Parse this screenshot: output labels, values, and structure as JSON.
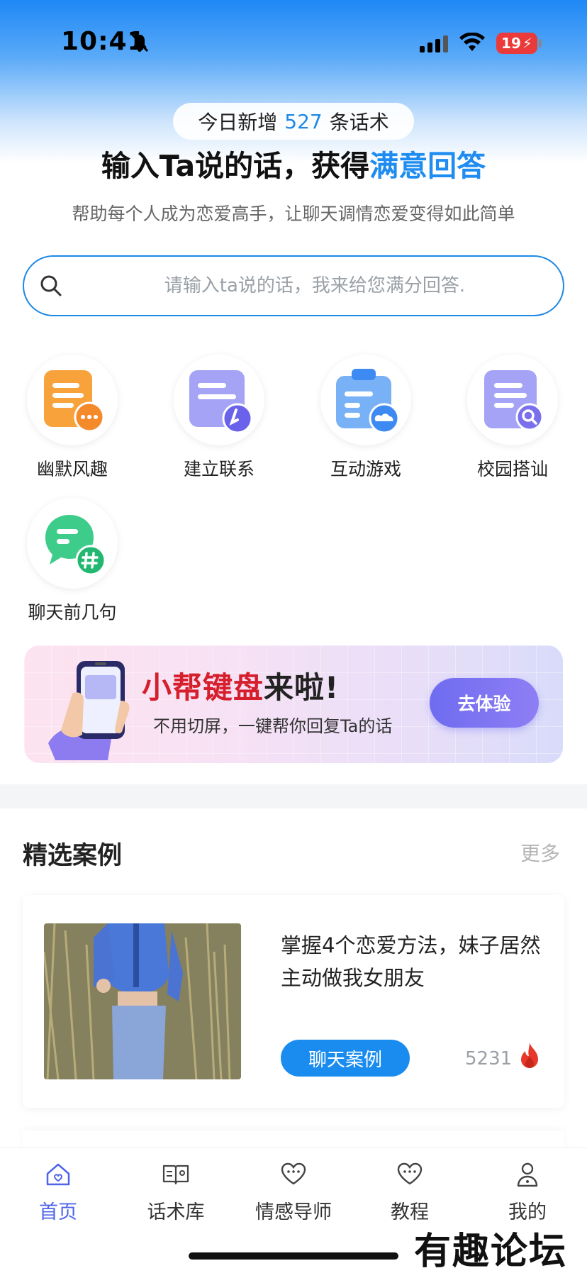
{
  "status": {
    "time": "10:41",
    "battery": "19"
  },
  "hero": {
    "pill_prefix": "今日新增",
    "pill_count": "527",
    "pill_suffix": "条话术",
    "headline_main": "输入Ta说的话，获得",
    "headline_highlight": "满意回答",
    "subline": "帮助每个人成为恋爱高手，让聊天调情恋爱变得如此简单"
  },
  "search": {
    "placeholder": "请输入ta说的话，我来给您满分回答."
  },
  "categories": [
    {
      "label": "幽默风趣",
      "icon": "humor-icon",
      "color": "#f7a23a"
    },
    {
      "label": "建立联系",
      "icon": "connect-icon",
      "color": "#8f8cf2"
    },
    {
      "label": "互动游戏",
      "icon": "game-icon",
      "color": "#5b9df5"
    },
    {
      "label": "校园搭讪",
      "icon": "campus-icon",
      "color": "#8f8cf2"
    },
    {
      "label": "聊天前几句",
      "icon": "opener-icon",
      "color": "#3dcc8a"
    }
  ],
  "banner": {
    "title_red": "小帮键盘",
    "title_dark": "来啦!",
    "subtitle": "不用切屏，一键帮你回复Ta的话",
    "button": "去体验"
  },
  "featured": {
    "title": "精选案例",
    "more": "更多",
    "cases": [
      {
        "title": "掌握4个恋爱方法，妹子居然主动做我女朋友",
        "tag": "聊天案例",
        "views": "5231"
      }
    ]
  },
  "tabbar": [
    {
      "label": "首页",
      "icon": "home-icon",
      "active": true
    },
    {
      "label": "话术库",
      "icon": "book-icon",
      "active": false
    },
    {
      "label": "情感导师",
      "icon": "heart-chat-icon",
      "active": false
    },
    {
      "label": "教程",
      "icon": "heart-chat-icon",
      "active": false
    },
    {
      "label": "我的",
      "icon": "user-icon",
      "active": false
    }
  ],
  "watermark": "有趣论坛",
  "colors": {
    "accent": "#1e88e5",
    "tab_active": "#4f64e9",
    "banner_red": "#d61f2c"
  }
}
